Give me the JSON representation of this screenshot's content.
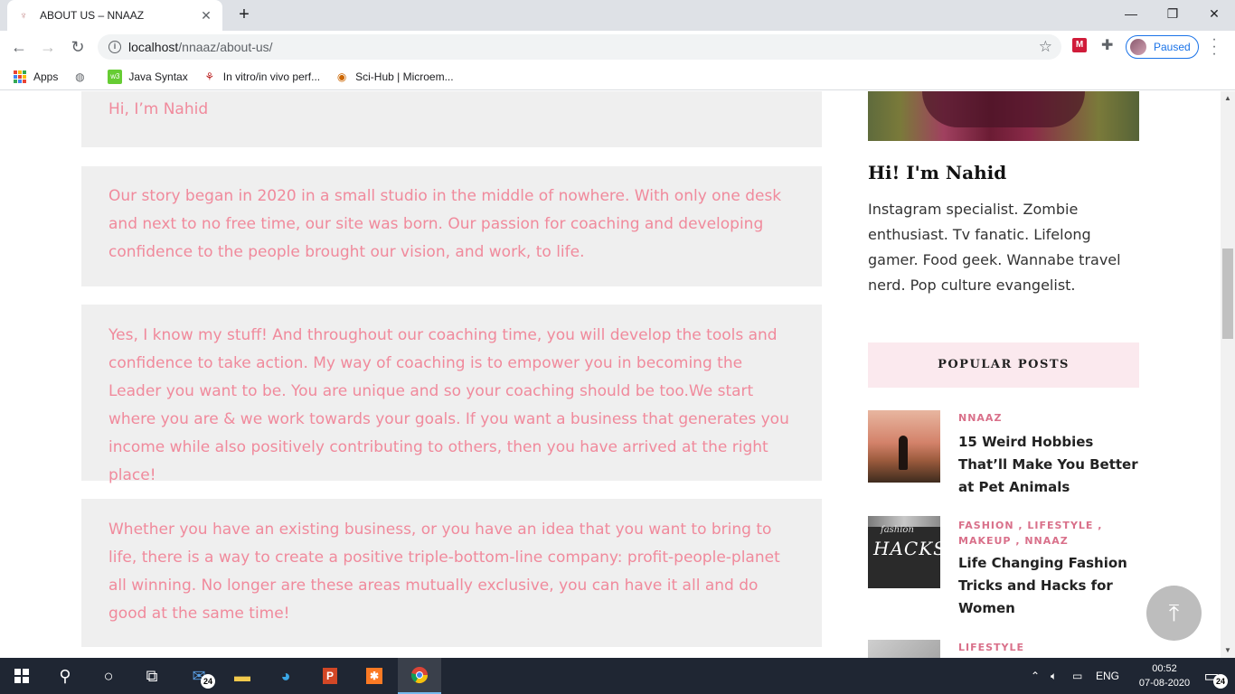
{
  "browser": {
    "tab_title": "ABOUT US – NNAAZ",
    "url_host": "localhost",
    "url_path": "/nnaaz/about-us/",
    "profile_status": "Paused",
    "bookmarks": [
      {
        "label": "Apps",
        "icon": "apps-grid-icon"
      },
      {
        "label": "",
        "icon": "globe-icon"
      },
      {
        "label": "Java Syntax",
        "icon": "site-favicon"
      },
      {
        "label": "In vitro/in vivo perf...",
        "icon": "site-favicon"
      },
      {
        "label": "Sci-Hub | Microem...",
        "icon": "site-favicon"
      }
    ]
  },
  "page": {
    "boxes": [
      "Hi, I’m Nahid",
      "Our story began in 2020 in a small studio in the middle of nowhere. With only one desk and next to no free time, our site was born. Our passion for coaching and developing confidence to the people brought our vision, and work, to life.",
      "Yes, I know my stuff! And throughout our coaching time, you will develop the tools and confidence to take action. My way of coaching is to empower you in becoming the Leader you want to be. You are unique and so your coaching should be too.We start where you are & we work towards your goals. If you want a business that generates you income while also positively contributing to others, then you have arrived at the right place!",
      "Whether you have an existing business, or you have an idea that you want to bring to life, there is a way to create a positive triple-bottom-line company: profit-people-planet all winning. No longer are these areas mutually exclusive, you can have it all and do good at the same time!"
    ],
    "text_color": "#f08a9c"
  },
  "sidebar": {
    "author_name": "Hi! I'm Nahid",
    "author_bio": "Instagram specialist. Zombie enthusiast. Tv fanatic. Lifelong gamer. Food geek. Wannabe travel nerd. Pop culture evangelist.",
    "popular_heading": "POPULAR POSTS",
    "posts": [
      {
        "categories": "NNAAZ",
        "title": "15 Weird Hobbies That’ll Make You Better at Pet Animals"
      },
      {
        "categories": "FASHION , LIFESTYLE , MAKEUP , NNAAZ",
        "title": "Life Changing Fashion Tricks and Hacks for Women",
        "thumb_text": "HACKS",
        "thumb_small": "fashion"
      },
      {
        "categories": "LIFESTYLE",
        "title": ""
      }
    ]
  },
  "taskbar": {
    "mail_badge": "24",
    "language": "ENG",
    "time": "00:52",
    "date": "07-08-2020",
    "notification_badge": "24"
  }
}
